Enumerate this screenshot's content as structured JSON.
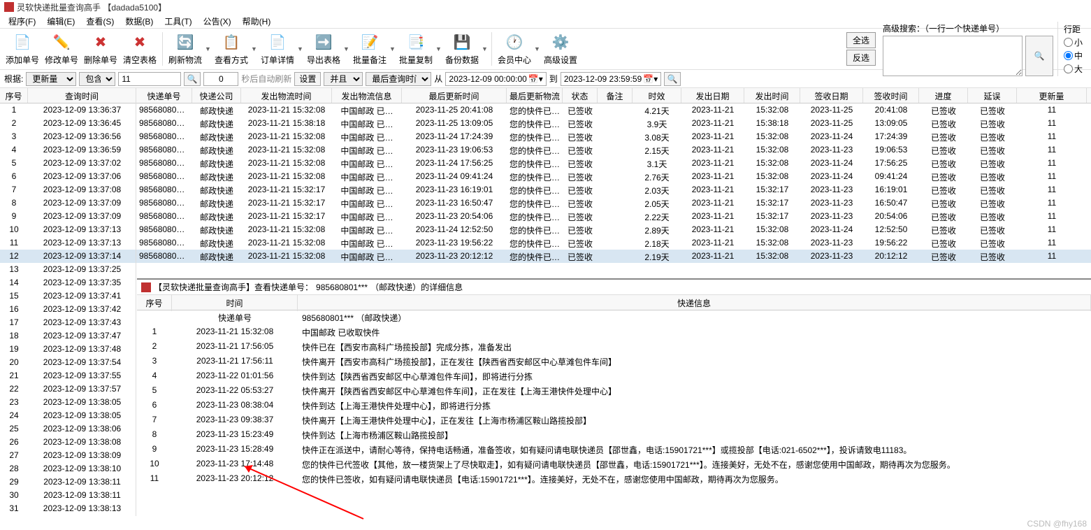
{
  "title": "灵软快递批量查询高手 【dadada5100】",
  "menus": [
    "程序(F)",
    "编辑(E)",
    "查看(S)",
    "数据(B)",
    "工具(T)",
    "公告(X)",
    "帮助(H)"
  ],
  "toolbar": [
    {
      "name": "add",
      "label": "添加单号",
      "icon": "📄",
      "color": "#2b6cb0"
    },
    {
      "name": "edit",
      "label": "修改单号",
      "icon": "✏️",
      "color": "#d69e2e"
    },
    {
      "name": "delete",
      "label": "删除单号",
      "icon": "✖",
      "color": "#cc3333",
      "overlay": "📄"
    },
    {
      "name": "clear",
      "label": "清空表格",
      "icon": "✖",
      "color": "#cc3333"
    },
    {
      "name": "refresh",
      "label": "刷新物流",
      "icon": "🔄",
      "color": "#2b9348"
    },
    {
      "name": "viewmode",
      "label": "查看方式",
      "icon": "📋",
      "color": "#2b9348"
    },
    {
      "name": "detail",
      "label": "订单详情",
      "icon": "📄",
      "color": "#6b7280"
    },
    {
      "name": "export",
      "label": "导出表格",
      "icon": "➡️",
      "color": "#2b9348"
    },
    {
      "name": "batchnote",
      "label": "批量备注",
      "icon": "📝",
      "color": "#6b7280"
    },
    {
      "name": "batchcopy",
      "label": "批量复制",
      "icon": "📑",
      "color": "#6b7280"
    },
    {
      "name": "backup",
      "label": "备份数据",
      "icon": "💾",
      "color": "#d69e2e"
    },
    {
      "name": "member",
      "label": "会员中心",
      "icon": "🕐",
      "color": "#2b6cb0"
    },
    {
      "name": "settings",
      "label": "高级设置",
      "icon": "⚙️",
      "color": "#6b7280"
    }
  ],
  "toolbar_dropdowns_after": [
    "refresh",
    "viewmode",
    "detail",
    "export",
    "batchnote",
    "batchcopy",
    "backup",
    "member"
  ],
  "side_buttons": {
    "all": "全选",
    "inv": "反选"
  },
  "adv_search": {
    "label": "高级搜索：（一行一个快递单号）",
    "go": "🔍"
  },
  "row_spacing": {
    "title": "行距",
    "small": "小",
    "medium": "中",
    "large": "大",
    "selected": "medium"
  },
  "filter": {
    "root_label": "根据:",
    "field": "更新量",
    "op": "包含",
    "value": "11",
    "count": "0",
    "auto_refresh": "秒后自动刷新",
    "set": "设置",
    "and": "并且 ▾",
    "last_field": "最后查询时间",
    "from_label": "从",
    "from": "2023-12-09 00:00:00",
    "to_label": "到",
    "to": "2023-12-09 23:59:59"
  },
  "left_headers": [
    "序号",
    "查询时间"
  ],
  "right_headers": [
    "快递单号",
    "快递公司",
    "发出物流时间",
    "发出物流信息",
    "最后更新时间",
    "最后更新物流",
    "状态",
    "备注",
    "时效",
    "发出日期",
    "发出时间",
    "签收日期",
    "签收时间",
    "进度",
    "延误",
    "更新量"
  ],
  "left_rows": [
    {
      "n": "1",
      "t": "2023-12-09 13:36:37"
    },
    {
      "n": "2",
      "t": "2023-12-09 13:36:45"
    },
    {
      "n": "3",
      "t": "2023-12-09 13:36:56"
    },
    {
      "n": "4",
      "t": "2023-12-09 13:36:59"
    },
    {
      "n": "5",
      "t": "2023-12-09 13:37:02"
    },
    {
      "n": "6",
      "t": "2023-12-09 13:37:06"
    },
    {
      "n": "7",
      "t": "2023-12-09 13:37:08"
    },
    {
      "n": "8",
      "t": "2023-12-09 13:37:09"
    },
    {
      "n": "9",
      "t": "2023-12-09 13:37:09"
    },
    {
      "n": "10",
      "t": "2023-12-09 13:37:13"
    },
    {
      "n": "11",
      "t": "2023-12-09 13:37:13"
    },
    {
      "n": "12",
      "t": "2023-12-09 13:37:14"
    },
    {
      "n": "13",
      "t": "2023-12-09 13:37:25"
    },
    {
      "n": "14",
      "t": "2023-12-09 13:37:35"
    },
    {
      "n": "15",
      "t": "2023-12-09 13:37:41"
    },
    {
      "n": "16",
      "t": "2023-12-09 13:37:42"
    },
    {
      "n": "17",
      "t": "2023-12-09 13:37:43"
    },
    {
      "n": "18",
      "t": "2023-12-09 13:37:47"
    },
    {
      "n": "19",
      "t": "2023-12-09 13:37:48"
    },
    {
      "n": "20",
      "t": "2023-12-09 13:37:54"
    },
    {
      "n": "21",
      "t": "2023-12-09 13:37:55"
    },
    {
      "n": "22",
      "t": "2023-12-09 13:37:57"
    },
    {
      "n": "23",
      "t": "2023-12-09 13:38:05"
    },
    {
      "n": "24",
      "t": "2023-12-09 13:38:05"
    },
    {
      "n": "25",
      "t": "2023-12-09 13:38:06"
    },
    {
      "n": "26",
      "t": "2023-12-09 13:38:08"
    },
    {
      "n": "27",
      "t": "2023-12-09 13:38:09"
    },
    {
      "n": "28",
      "t": "2023-12-09 13:38:10"
    },
    {
      "n": "29",
      "t": "2023-12-09 13:38:11"
    },
    {
      "n": "30",
      "t": "2023-12-09 13:38:11"
    },
    {
      "n": "31",
      "t": "2023-12-09 13:38:13"
    }
  ],
  "right_rows": [
    {
      "no": "985680801…",
      "co": "邮政快递",
      "st": "2023-11-21 15:32:08",
      "si": "中国邮政 已…",
      "lt": "2023-11-25 20:41:08",
      "li": "您的快件已…",
      "status": "已签收",
      "note": "",
      "dur": "4.21天",
      "sd": "2023-11-21",
      "stime": "15:32:08",
      "rd": "2023-11-25",
      "rtime": "20:41:08",
      "prog": "已签收",
      "delay": "已签收",
      "upd": "11"
    },
    {
      "no": "985680801…",
      "co": "邮政快递",
      "st": "2023-11-21 15:38:18",
      "si": "中国邮政 已…",
      "lt": "2023-11-25 13:09:05",
      "li": "您的快件已…",
      "status": "已签收",
      "note": "",
      "dur": "3.9天",
      "sd": "2023-11-21",
      "stime": "15:38:18",
      "rd": "2023-11-25",
      "rtime": "13:09:05",
      "prog": "已签收",
      "delay": "已签收",
      "upd": "11"
    },
    {
      "no": "985680801…",
      "co": "邮政快递",
      "st": "2023-11-21 15:32:08",
      "si": "中国邮政 已…",
      "lt": "2023-11-24 17:24:39",
      "li": "您的快件已…",
      "status": "已签收",
      "note": "",
      "dur": "3.08天",
      "sd": "2023-11-21",
      "stime": "15:32:08",
      "rd": "2023-11-24",
      "rtime": "17:24:39",
      "prog": "已签收",
      "delay": "已签收",
      "upd": "11"
    },
    {
      "no": "985680801…",
      "co": "邮政快递",
      "st": "2023-11-21 15:32:08",
      "si": "中国邮政 已…",
      "lt": "2023-11-23 19:06:53",
      "li": "您的快件已…",
      "status": "已签收",
      "note": "",
      "dur": "2.15天",
      "sd": "2023-11-21",
      "stime": "15:32:08",
      "rd": "2023-11-23",
      "rtime": "19:06:53",
      "prog": "已签收",
      "delay": "已签收",
      "upd": "11"
    },
    {
      "no": "985680801…",
      "co": "邮政快递",
      "st": "2023-11-21 15:32:08",
      "si": "中国邮政 已…",
      "lt": "2023-11-24 17:56:25",
      "li": "您的快件已…",
      "status": "已签收",
      "note": "",
      "dur": "3.1天",
      "sd": "2023-11-21",
      "stime": "15:32:08",
      "rd": "2023-11-24",
      "rtime": "17:56:25",
      "prog": "已签收",
      "delay": "已签收",
      "upd": "11"
    },
    {
      "no": "985680801…",
      "co": "邮政快递",
      "st": "2023-11-21 15:32:08",
      "si": "中国邮政 已…",
      "lt": "2023-11-24 09:41:24",
      "li": "您的快件已…",
      "status": "已签收",
      "note": "",
      "dur": "2.76天",
      "sd": "2023-11-21",
      "stime": "15:32:08",
      "rd": "2023-11-24",
      "rtime": "09:41:24",
      "prog": "已签收",
      "delay": "已签收",
      "upd": "11"
    },
    {
      "no": "985680801…",
      "co": "邮政快递",
      "st": "2023-11-21 15:32:17",
      "si": "中国邮政 已…",
      "lt": "2023-11-23 16:19:01",
      "li": "您的快件已…",
      "status": "已签收",
      "note": "",
      "dur": "2.03天",
      "sd": "2023-11-21",
      "stime": "15:32:17",
      "rd": "2023-11-23",
      "rtime": "16:19:01",
      "prog": "已签收",
      "delay": "已签收",
      "upd": "11"
    },
    {
      "no": "985680801…",
      "co": "邮政快递",
      "st": "2023-11-21 15:32:17",
      "si": "中国邮政 已…",
      "lt": "2023-11-23 16:50:47",
      "li": "您的快件已…",
      "status": "已签收",
      "note": "",
      "dur": "2.05天",
      "sd": "2023-11-21",
      "stime": "15:32:17",
      "rd": "2023-11-23",
      "rtime": "16:50:47",
      "prog": "已签收",
      "delay": "已签收",
      "upd": "11"
    },
    {
      "no": "985680801…",
      "co": "邮政快递",
      "st": "2023-11-21 15:32:17",
      "si": "中国邮政 已…",
      "lt": "2023-11-23 20:54:06",
      "li": "您的快件已…",
      "status": "已签收",
      "note": "",
      "dur": "2.22天",
      "sd": "2023-11-21",
      "stime": "15:32:17",
      "rd": "2023-11-23",
      "rtime": "20:54:06",
      "prog": "已签收",
      "delay": "已签收",
      "upd": "11"
    },
    {
      "no": "985680801…",
      "co": "邮政快递",
      "st": "2023-11-21 15:32:08",
      "si": "中国邮政 已…",
      "lt": "2023-11-24 12:52:50",
      "li": "您的快件已…",
      "status": "已签收",
      "note": "",
      "dur": "2.89天",
      "sd": "2023-11-21",
      "stime": "15:32:08",
      "rd": "2023-11-24",
      "rtime": "12:52:50",
      "prog": "已签收",
      "delay": "已签收",
      "upd": "11"
    },
    {
      "no": "985680801…",
      "co": "邮政快递",
      "st": "2023-11-21 15:32:08",
      "si": "中国邮政 已…",
      "lt": "2023-11-23 19:56:22",
      "li": "您的快件已…",
      "status": "已签收",
      "note": "",
      "dur": "2.18天",
      "sd": "2023-11-21",
      "stime": "15:32:08",
      "rd": "2023-11-23",
      "rtime": "19:56:22",
      "prog": "已签收",
      "delay": "已签收",
      "upd": "11"
    },
    {
      "no": "985680801…",
      "co": "邮政快递",
      "st": "2023-11-21 15:32:08",
      "si": "中国邮政 已…",
      "lt": "2023-11-23 20:12:12",
      "li": "您的快件已…",
      "status": "已签收",
      "note": "",
      "dur": "2.19天",
      "sd": "2023-11-21",
      "stime": "15:32:08",
      "rd": "2023-11-23",
      "rtime": "20:12:12",
      "prog": "已签收",
      "delay": "已签收",
      "upd": "11"
    }
  ],
  "selected_row": 11,
  "detail": {
    "title_prefix": "【灵软快递批量查询高手】查看快递单号：",
    "tracking": "985680801***",
    "paren": "（邮政快递）的详细信息",
    "headers": [
      "序号",
      "时间",
      "快递信息"
    ],
    "subheader": "快递单号",
    "subvalue": "985680801***  （邮政快递）",
    "rows": [
      {
        "n": "1",
        "t": "2023-11-21 15:32:08",
        "m": "中国邮政 已收取快件"
      },
      {
        "n": "2",
        "t": "2023-11-21 17:56:05",
        "m": "快件已在【西安市高科广场揽投部】完成分拣，准备发出"
      },
      {
        "n": "3",
        "t": "2023-11-21 17:56:11",
        "m": "快件离开【西安市高科广场揽投部】，正在发往【陕西省西安邮区中心草滩包件车间】"
      },
      {
        "n": "4",
        "t": "2023-11-22 01:01:56",
        "m": "快件到达【陕西省西安邮区中心草滩包件车间】，即将进行分拣"
      },
      {
        "n": "5",
        "t": "2023-11-22 05:53:27",
        "m": "快件离开【陕西省西安邮区中心草滩包件车间】，正在发往【上海王港快件处理中心】"
      },
      {
        "n": "6",
        "t": "2023-11-23 08:38:04",
        "m": "快件到达【上海王港快件处理中心】，即将进行分拣"
      },
      {
        "n": "7",
        "t": "2023-11-23 09:38:37",
        "m": "快件离开【上海王港快件处理中心】，正在发往【上海市杨浦区鞍山路揽投部】"
      },
      {
        "n": "8",
        "t": "2023-11-23 15:23:49",
        "m": "快件到达【上海市杨浦区鞍山路揽投部】"
      },
      {
        "n": "9",
        "t": "2023-11-23 15:28:49",
        "m": "快件正在派送中，请耐心等待，保持电话畅通，准备签收，如有疑问请电联快递员【邵世鑫，电话:15901721***】或揽投部【电话:021-6502***】，投诉请致电11183。"
      },
      {
        "n": "10",
        "t": "2023-11-23 17:14:48",
        "m": "您的快件已代签收【其他，放一楼货架上了尽快取走】，如有疑问请电联快递员【邵世鑫，电话:15901721***】。连接美好，无处不在，感谢您使用中国邮政，期待再次为您服务。"
      },
      {
        "n": "11",
        "t": "2023-11-23 20:12:12",
        "m": "您的快件已签收，如有疑问请电联快递员【电话:15901721***】。连接美好，无处不在，感谢您使用中国邮政，期待再次为您服务。"
      }
    ]
  },
  "watermark": "CSDN @fhy168"
}
